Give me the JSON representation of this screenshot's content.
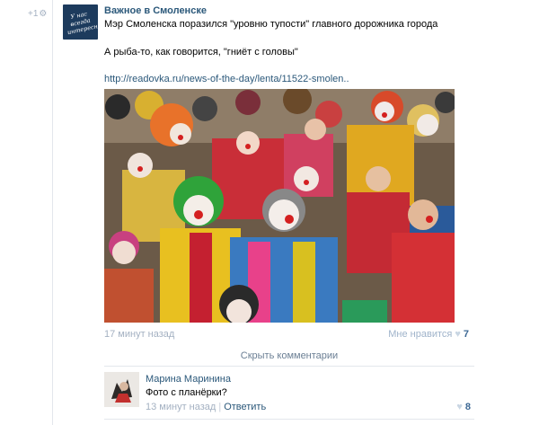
{
  "post": {
    "repost_count": "+1",
    "group_name": "Важное в Смоленске",
    "group_logo_text": "У нас всегда интересно!",
    "text_line_1": "Мэр Смоленска поразился \"уровню тупости\" главного дорожника города",
    "text_line_2": "А рыба-то, как говорится, \"гниёт с головы\"",
    "link": "http://readovka.ru/news-of-the-day/lenta/11522-smolen..",
    "time": "17 минут назад",
    "like_label": "Мне нравится",
    "like_count": "7"
  },
  "comments_bar": {
    "hide_label": "Скрыть комментарии"
  },
  "comment": {
    "author": "Марина Маринина",
    "text": "Фото с планёрки?",
    "time": "13 минут назад",
    "separator": "|",
    "reply_label": "Ответить",
    "like_count": "8"
  },
  "colors": {
    "link": "#2b587a",
    "muted": "#a4b1c2",
    "divider": "#e3e7ec"
  },
  "icons": [
    "clown-photo",
    "heart-icon",
    "share-mark-icon"
  ]
}
